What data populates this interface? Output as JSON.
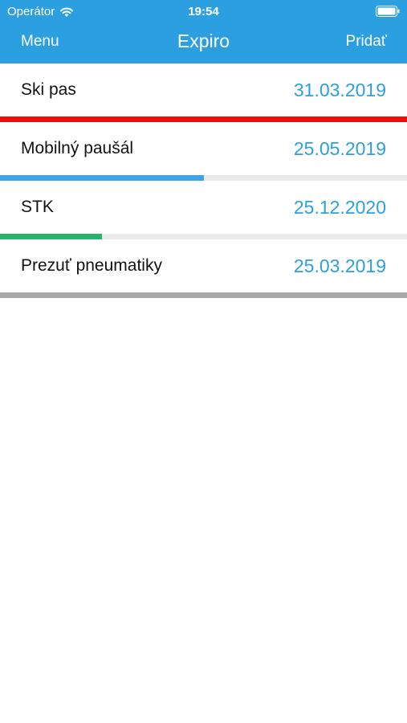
{
  "status_bar": {
    "carrier": "Operátor",
    "time": "19:54",
    "wifi_icon": "wifi-icon",
    "battery_icon": "battery-icon"
  },
  "nav": {
    "left_label": "Menu",
    "title": "Expiro",
    "right_label": "Pridať"
  },
  "colors": {
    "accent": "#2c9fe0",
    "track": "#eaeaea",
    "row_text": "#111111"
  },
  "items": [
    {
      "label": "Ski pas",
      "date": "31.03.2019",
      "progress": 1.0,
      "progress_color": "#f20d0d"
    },
    {
      "label": "Mobilný paušál",
      "date": "25.05.2019",
      "progress": 0.5,
      "progress_color": "#3aa6e8"
    },
    {
      "label": "STK",
      "date": "25.12.2020",
      "progress": 0.25,
      "progress_color": "#27b36b"
    },
    {
      "label": "Prezuť pneumatiky",
      "date": "25.03.2019",
      "progress": 1.0,
      "progress_color": "#a9a9a9"
    }
  ]
}
